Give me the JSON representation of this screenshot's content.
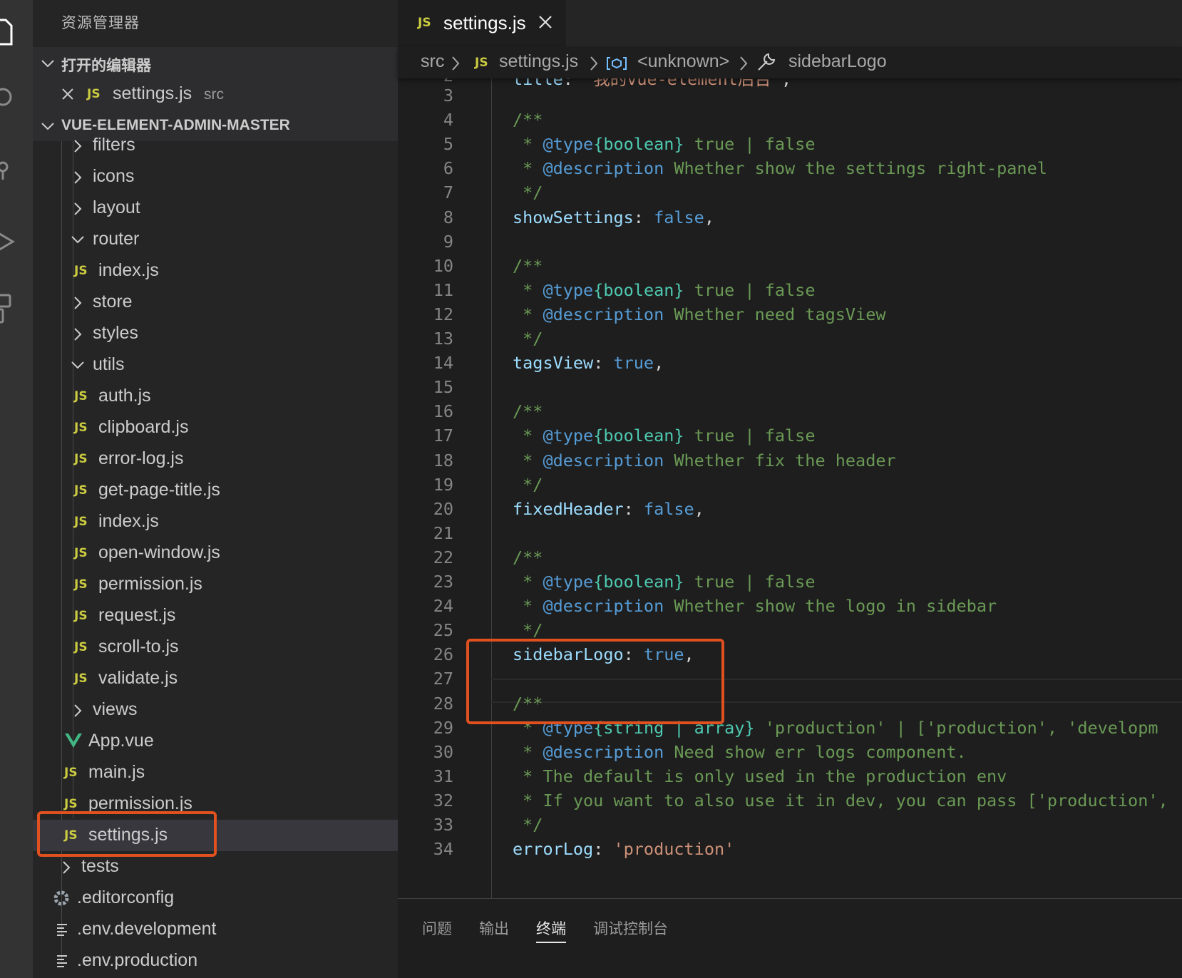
{
  "sidebar": {
    "title": "资源管理器",
    "open_editors_label": "打开的编辑器",
    "open_editor": {
      "name": "settings.js",
      "path": "src"
    },
    "project_label": "VUE-ELEMENT-ADMIN-MASTER",
    "tree": [
      {
        "label": "filters",
        "kind": "folder"
      },
      {
        "label": "icons",
        "kind": "folder"
      },
      {
        "label": "layout",
        "kind": "folder"
      },
      {
        "label": "router",
        "kind": "folder-open"
      },
      {
        "label": "index.js",
        "kind": "js"
      },
      {
        "label": "store",
        "kind": "folder"
      },
      {
        "label": "styles",
        "kind": "folder"
      },
      {
        "label": "utils",
        "kind": "folder-open"
      },
      {
        "label": "auth.js",
        "kind": "js"
      },
      {
        "label": "clipboard.js",
        "kind": "js"
      },
      {
        "label": "error-log.js",
        "kind": "js"
      },
      {
        "label": "get-page-title.js",
        "kind": "js"
      },
      {
        "label": "index.js",
        "kind": "js"
      },
      {
        "label": "open-window.js",
        "kind": "js"
      },
      {
        "label": "permission.js",
        "kind": "js"
      },
      {
        "label": "request.js",
        "kind": "js"
      },
      {
        "label": "scroll-to.js",
        "kind": "js"
      },
      {
        "label": "validate.js",
        "kind": "js"
      },
      {
        "label": "views",
        "kind": "folder"
      },
      {
        "label": "App.vue",
        "kind": "vue"
      },
      {
        "label": "main.js",
        "kind": "js"
      },
      {
        "label": "permission.js",
        "kind": "js"
      },
      {
        "label": "settings.js",
        "kind": "js"
      },
      {
        "label": "tests",
        "kind": "folder"
      },
      {
        "label": ".editorconfig",
        "kind": "config"
      },
      {
        "label": ".env.development",
        "kind": "env"
      },
      {
        "label": ".env.production",
        "kind": "env"
      }
    ]
  },
  "tab": {
    "label": "settings.js",
    "icon": "JS"
  },
  "breadcrumb": {
    "folder": "src",
    "file": "settings.js",
    "symbol1": "<unknown>",
    "symbol2": "sidebarLogo"
  },
  "code": {
    "top_partial": "title: '我的vue-element后台',",
    "line_numbers": [
      "3",
      "4",
      "5",
      "6",
      "7",
      "8",
      "9",
      "10",
      "11",
      "12",
      "13",
      "14",
      "15",
      "16",
      "17",
      "18",
      "19",
      "20",
      "21",
      "22",
      "23",
      "24",
      "25",
      "26",
      "27",
      "28",
      "29",
      "30",
      "31",
      "32",
      "33",
      "34"
    ],
    "text": {
      "l3": "",
      "l4": "/**",
      "l5a": " * ",
      "l5b": "@type",
      "l5c": "{boolean}",
      "l5d": " true | false",
      "l6a": " * ",
      "l6b": "@description",
      "l6c": " Whether show the settings right-panel",
      "l7": " */",
      "l8a": "showSettings",
      "l8b": ": ",
      "l8c": "false",
      "l8d": ",",
      "l10": "/**",
      "l11a": " * ",
      "l11b": "@type",
      "l11c": "{boolean}",
      "l11d": " true | false",
      "l12a": " * ",
      "l12b": "@description",
      "l12c": " Whether need tagsView",
      "l13": " */",
      "l14a": "tagsView",
      "l14b": ": ",
      "l14c": "true",
      "l14d": ",",
      "l16": "/**",
      "l17a": " * ",
      "l17b": "@type",
      "l17c": "{boolean}",
      "l17d": " true | false",
      "l18a": " * ",
      "l18b": "@description",
      "l18c": " Whether fix the header",
      "l19": " */",
      "l20a": "fixedHeader",
      "l20b": ": ",
      "l20c": "false",
      "l20d": ",",
      "l22": "/**",
      "l23a": " * ",
      "l23b": "@type",
      "l23c": "{boolean}",
      "l23d": " true | false",
      "l24a": " * ",
      "l24b": "@description",
      "l24c": " Whether show the logo in sidebar",
      "l25": " */",
      "l26a": "sidebarLogo",
      "l26b": ": ",
      "l26c": "true",
      "l26d": ",",
      "l28": "/**",
      "l29a": " * ",
      "l29b": "@type",
      "l29c": "{string | array}",
      "l29d": " 'production' | ['production', 'developm",
      "l30a": " * ",
      "l30b": "@description",
      "l30c": " Need show err logs component.",
      "l31": " * The default is only used in the production env",
      "l32": " * If you want to also use it in dev, you can pass ['production', 'development']",
      "l33": " */",
      "l34a": "errorLog",
      "l34b": ": ",
      "l34c": "'production'"
    }
  },
  "panel": {
    "tabs": [
      "问题",
      "输出",
      "终端",
      "调试控制台"
    ],
    "active": "终端"
  },
  "colors": {
    "accent_red_box": "#e1501f",
    "js_badge": "#cbcb41",
    "vue_icon": "#41b883"
  }
}
